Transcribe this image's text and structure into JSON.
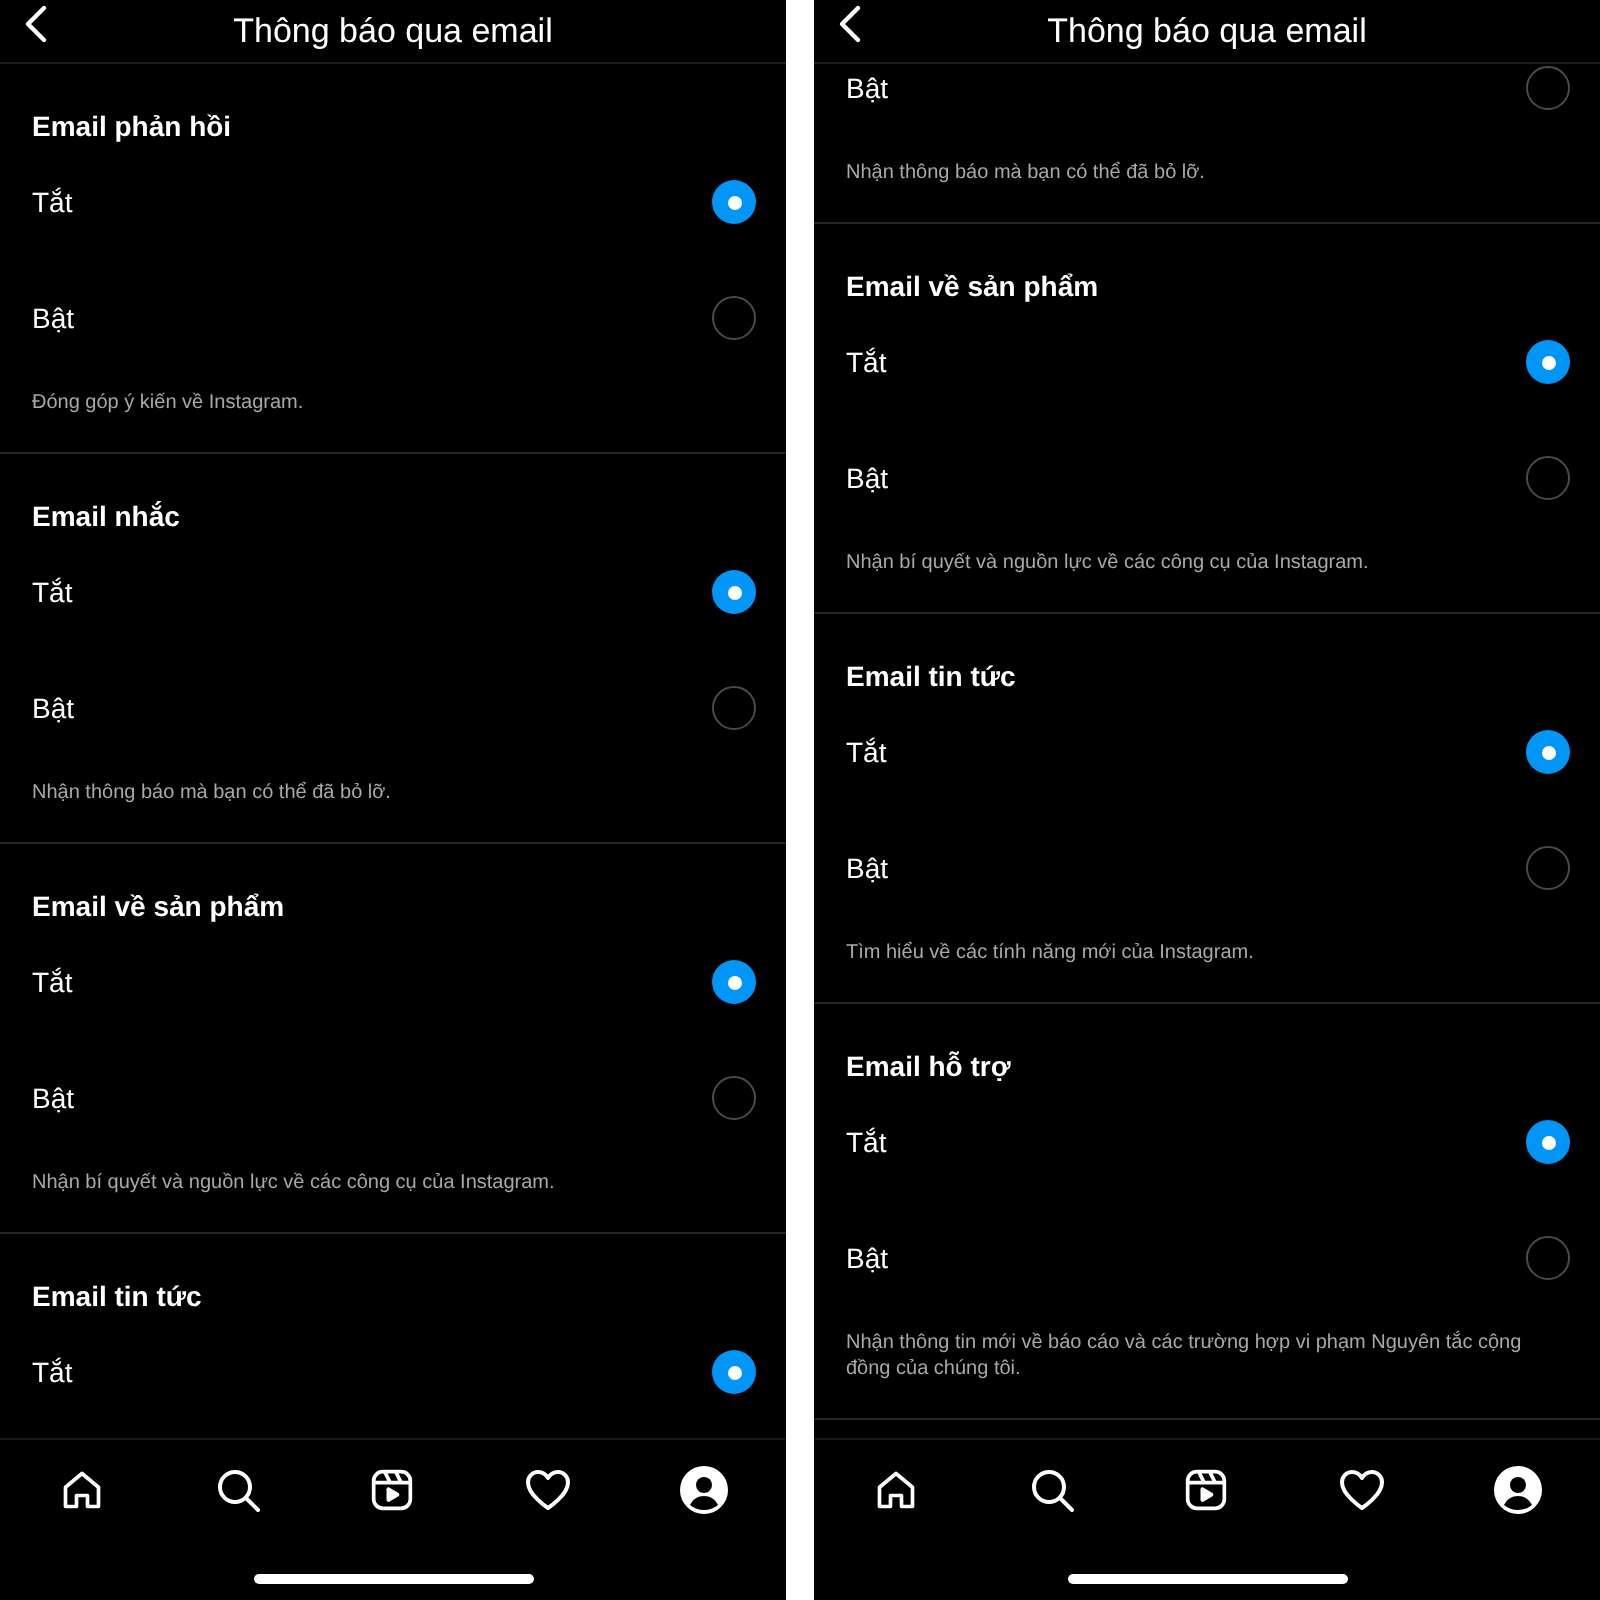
{
  "phones": [
    {
      "title": "Thông báo qua email",
      "sections": [
        {
          "heading": "Email phản hồi",
          "options": [
            {
              "label": "Tắt",
              "selected": true
            },
            {
              "label": "Bật",
              "selected": false
            }
          ],
          "description": "Đóng góp ý kiến về Instagram."
        },
        {
          "heading": "Email nhắc",
          "options": [
            {
              "label": "Tắt",
              "selected": true
            },
            {
              "label": "Bật",
              "selected": false
            }
          ],
          "description": "Nhận thông báo mà bạn có thể đã bỏ lỡ."
        },
        {
          "heading": "Email về sản phẩm",
          "options": [
            {
              "label": "Tắt",
              "selected": true
            },
            {
              "label": "Bật",
              "selected": false
            }
          ],
          "description": "Nhận bí quyết và nguồn lực về các công cụ của Instagram."
        },
        {
          "heading": "Email tin tức",
          "options": [
            {
              "label": "Tắt",
              "selected": true
            }
          ]
        }
      ]
    },
    {
      "title": "Thông báo qua email",
      "sections": [
        {
          "options": [
            {
              "label": "Bật",
              "selected": false
            }
          ],
          "description": "Nhận thông báo mà bạn có thể đã bỏ lỡ."
        },
        {
          "heading": "Email về sản phẩm",
          "options": [
            {
              "label": "Tắt",
              "selected": true
            },
            {
              "label": "Bật",
              "selected": false
            }
          ],
          "description": "Nhận bí quyết và nguồn lực về các công cụ của Instagram."
        },
        {
          "heading": "Email tin tức",
          "options": [
            {
              "label": "Tắt",
              "selected": true
            },
            {
              "label": "Bật",
              "selected": false
            }
          ],
          "description": "Tìm hiểu về các tính năng mới của Instagram."
        },
        {
          "heading": "Email hỗ trợ",
          "options": [
            {
              "label": "Tắt",
              "selected": true
            },
            {
              "label": "Bật",
              "selected": false
            }
          ],
          "description": "Nhận thông tin mới về báo cáo và các trường hợp vi phạm Nguyên tắc cộng đồng của chúng tôi."
        }
      ]
    }
  ]
}
